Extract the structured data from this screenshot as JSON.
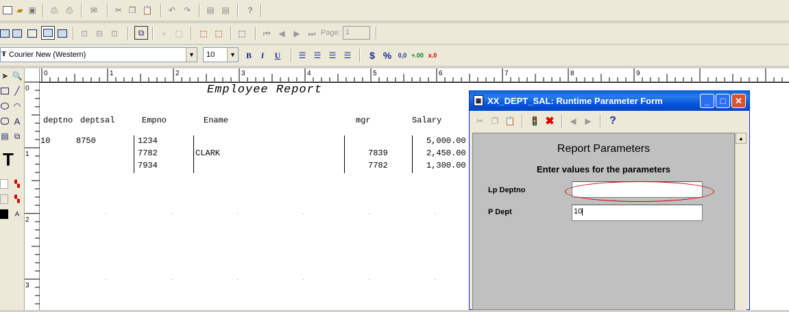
{
  "toolbar": {
    "font_name": "Courier New (Western)",
    "font_size": "10",
    "page_label": "Page:",
    "page_value": "1",
    "bold": "B",
    "italic": "I",
    "underline": "U",
    "currency": "$",
    "percent": "%",
    "comma": "0,0",
    "add_decimal": "+.00",
    "remove_decimal": "x.0"
  },
  "toolbox": {
    "text_tool": "T",
    "text_glyph": "A"
  },
  "ruler": {
    "h_ticks": [
      "0",
      "1",
      "2",
      "3",
      "4",
      "5",
      "6",
      "7",
      "8",
      "9"
    ],
    "v_ticks": [
      "0",
      "1",
      "2",
      "3"
    ]
  },
  "report": {
    "title": "Employee Report",
    "headers": {
      "deptno": "deptno",
      "deptsal": "deptsal",
      "empno": "Empno",
      "ename": "Ename",
      "mgr": "mgr",
      "salary": "Salary"
    },
    "group": {
      "deptno": "10",
      "deptsal": "8750"
    },
    "rows": [
      {
        "empno": "1234",
        "ename": "",
        "mgr": "",
        "salary": "5,000.00"
      },
      {
        "empno": "7782",
        "ename": "CLARK",
        "mgr": "7839",
        "salary": "2,450.00"
      },
      {
        "empno": "7934",
        "ename": "",
        "mgr": "7782",
        "salary": "1,300.00"
      }
    ]
  },
  "dialog": {
    "title": "XX_DEPT_SAL: Runtime Parameter Form",
    "heading": "Report Parameters",
    "subheading": "Enter values for the parameters",
    "params": [
      {
        "label": "Lp Deptno",
        "value": ""
      },
      {
        "label": "P Dept",
        "value": "10"
      }
    ],
    "help_glyph": "?",
    "minimize": "_",
    "maximize": "□",
    "close": "✕",
    "highlight_color": "#d00000"
  }
}
